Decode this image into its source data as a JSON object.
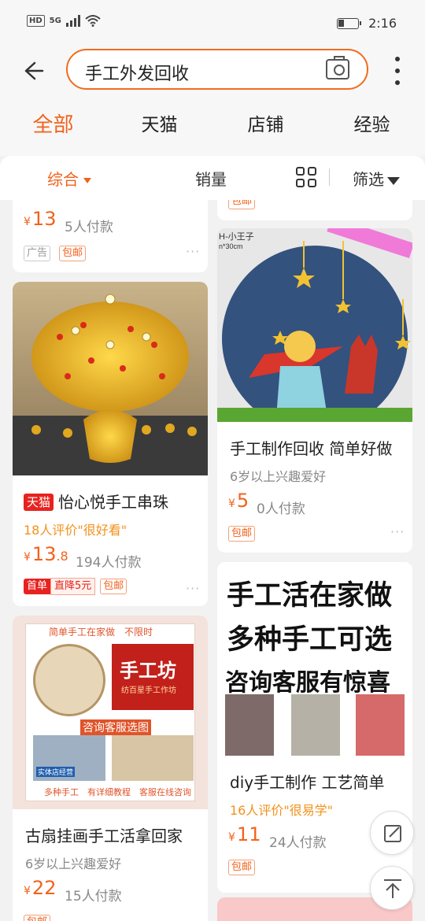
{
  "status_bar": {
    "left": "HD",
    "network": "5G",
    "time": "2:16"
  },
  "search": {
    "query": "手工外发回收"
  },
  "tabs": [
    {
      "label": "全部"
    },
    {
      "label": "天猫"
    },
    {
      "label": "店铺"
    },
    {
      "label": "经验"
    }
  ],
  "filters": {
    "sort": "综合",
    "sales": "销量",
    "filter": "筛选"
  },
  "colors": {
    "accent": "#f2621c",
    "tmall": "#e6231f"
  },
  "left_column": [
    {
      "price_int": "13",
      "paid": "5人付款",
      "tags": [
        "广告",
        "包邮"
      ]
    },
    {
      "badge": "天猫",
      "title": "怡心悦手工串珠",
      "review": "18人评价\"很好看\"",
      "price_int": "13",
      "price_dec": ".8",
      "paid": "194人付款",
      "promo_badge": "首单",
      "promo_text": "直降5元",
      "tags": [
        "包邮"
      ]
    },
    {
      "image_text_top": "简单手工在家做　不限时",
      "image_sign": "手工坊",
      "image_sign_sub": "纺百星手工作坊",
      "image_overlay": "咨询客服选图",
      "image_store": "实体店经营",
      "image_bottom": "多种手工　有详细教程　客服在线咨询",
      "title": "古扇挂画手工活拿回家",
      "sub": "6岁以上兴趣爱好",
      "price_int": "22",
      "paid": "15人付款",
      "tags": [
        "包邮"
      ]
    }
  ],
  "right_column": [
    {
      "tags": [
        "包邮"
      ]
    },
    {
      "image_label": "H-小王子",
      "image_label2": "n*30cm",
      "title": "手工制作回收 简单好做",
      "sub": "6岁以上兴趣爱好",
      "price_int": "5",
      "paid": "0人付款",
      "tags": [
        "包邮"
      ]
    },
    {
      "image_lines": [
        "手工活在家做",
        "多种手工可选",
        "咨询客服有惊喜"
      ],
      "title": "diy手工制作 工艺简单",
      "review": "16人评价\"很易学\"",
      "price_int": "11",
      "paid": "24人付款",
      "tags": [
        "包邮"
      ]
    }
  ],
  "currency": "¥",
  "more_dots": "···"
}
